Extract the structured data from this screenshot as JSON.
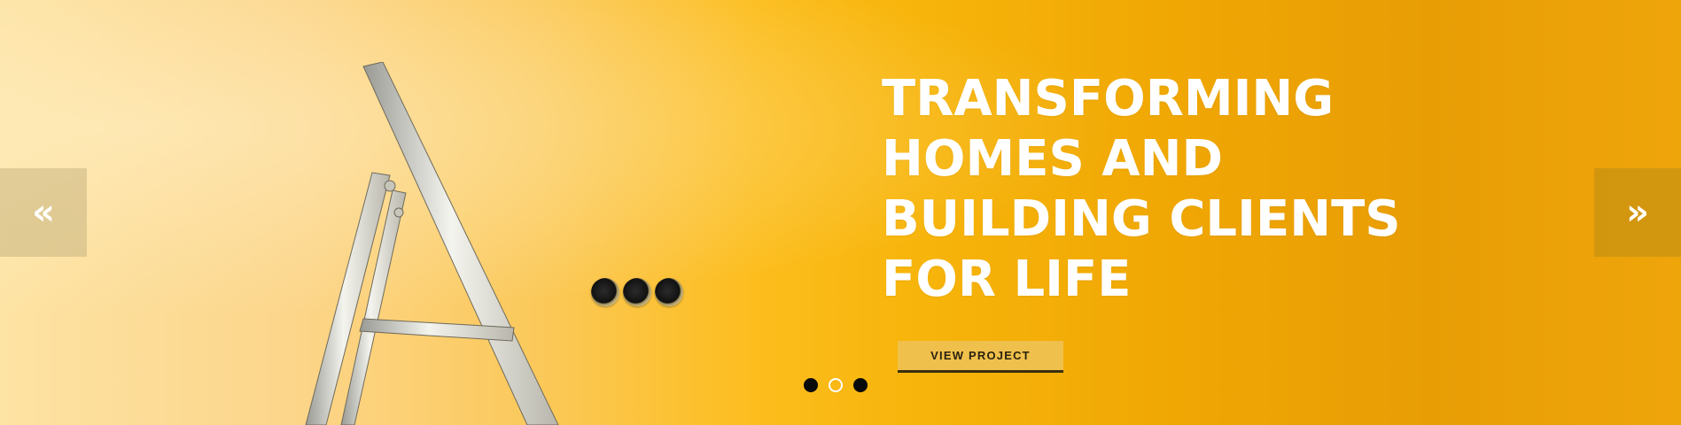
{
  "slider": {
    "headline_lines": [
      "TRANSFORMING",
      "HOMES AND",
      "BUILDING CLIENTS",
      "FOR LIFE"
    ],
    "cta_label": "VIEW PROJECT",
    "prev_arrow": "«",
    "next_arrow": "»",
    "prev_icon": "double-chevron-left-icon",
    "next_icon": "double-chevron-right-icon",
    "slide_count": 3,
    "active_slide": 2
  },
  "colors": {
    "background_start": "#fde3a4",
    "background_end": "#e89d05",
    "cta_background": "#f0c04c",
    "cta_text": "#2a2210",
    "headline": "#ffffff"
  }
}
